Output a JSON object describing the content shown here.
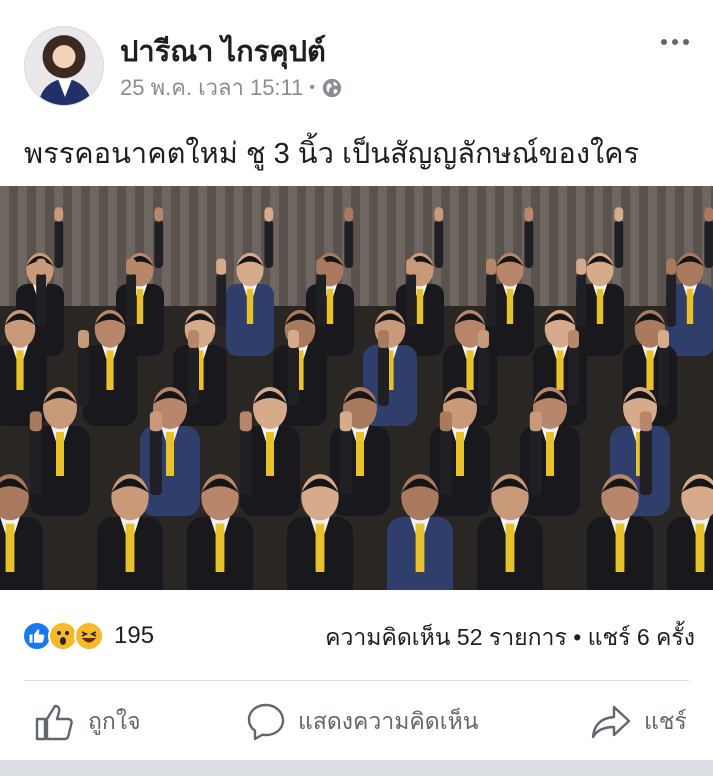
{
  "post": {
    "author": "ปารีณา ไกรคุปต์",
    "timestamp": "25 พ.ค. เวลา 15:11",
    "separator": "•",
    "privacy_icon": "globe-icon",
    "more_icon": "more-options-icon",
    "text": "พรรคอนาคตใหม่ ชู 3 นิ้ว เป็นสัญญลักษณ์ของใคร"
  },
  "reactions": {
    "icons": [
      "like-reaction-icon",
      "wow-reaction-icon",
      "haha-reaction-icon"
    ],
    "count": "195"
  },
  "stats": {
    "comments": "ความคิดเห็น 52 รายการ",
    "separator": "•",
    "shares": "แชร์ 6 ครั้ง"
  },
  "actions": {
    "like_label": "ถูกใจ",
    "comment_label": "แสดงความคิดเห็น",
    "share_label": "แชร์"
  },
  "colors": {
    "brand_blue": "#1877f2",
    "reaction_yellow": "#f7b928",
    "secondary_text": "#606770",
    "tie_yellow": "#e8c22a"
  }
}
